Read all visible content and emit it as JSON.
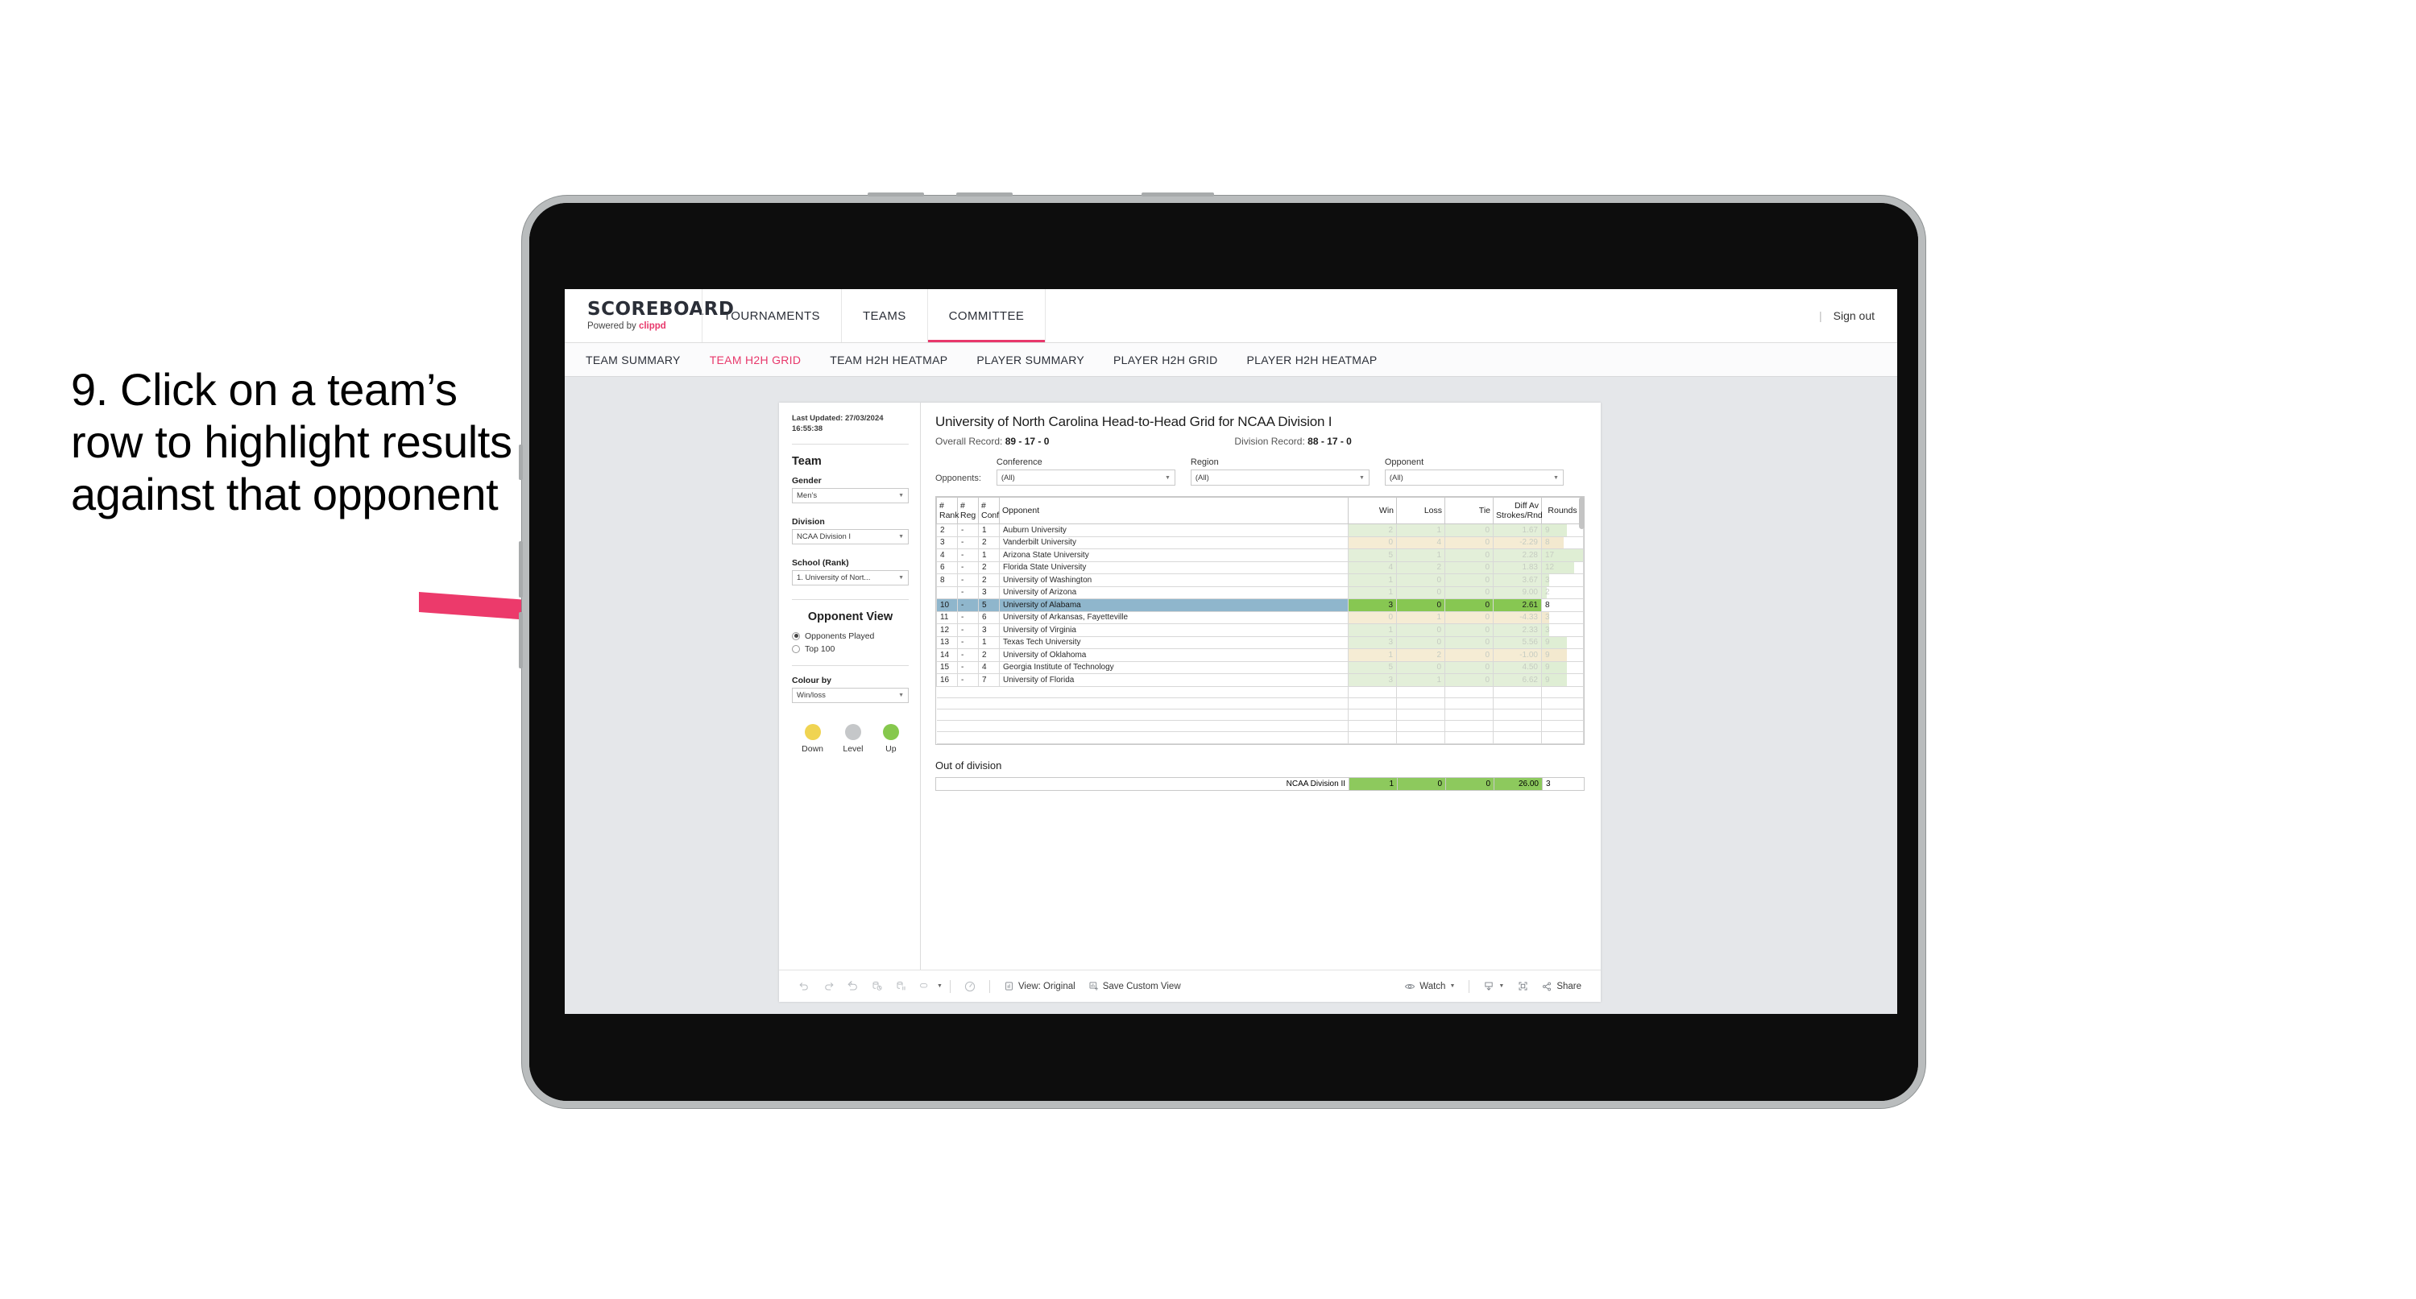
{
  "annotation": {
    "text": "9. Click on a team’s row to highlight results against that opponent",
    "arrow_color": "#EC3A6B"
  },
  "topnav": {
    "brand_name": "SCOREBOARD",
    "brand_sub_prefix": "Powered by ",
    "brand_sub_accent": "clippd",
    "items": [
      {
        "label": "TOURNAMENTS",
        "active": false
      },
      {
        "label": "TEAMS",
        "active": false
      },
      {
        "label": "COMMITTEE",
        "active": true
      }
    ],
    "divider": "|",
    "sign_out": "Sign out",
    "accent_color": "#E8386B"
  },
  "subnav": {
    "items": [
      {
        "label": "TEAM SUMMARY",
        "active": false
      },
      {
        "label": "TEAM H2H GRID",
        "active": true
      },
      {
        "label": "TEAM H2H HEATMAP",
        "active": false
      },
      {
        "label": "PLAYER SUMMARY",
        "active": false
      },
      {
        "label": "PLAYER H2H GRID",
        "active": false
      },
      {
        "label": "PLAYER H2H HEATMAP",
        "active": false
      }
    ]
  },
  "sidebar": {
    "last_updated_line1": "Last Updated: 27/03/2024",
    "last_updated_line2": "16:55:38",
    "team_heading": "Team",
    "gender": {
      "label": "Gender",
      "value": "Men’s"
    },
    "division": {
      "label": "Division",
      "value": "NCAA Division I"
    },
    "school": {
      "label": "School (Rank)",
      "value": "1. University of Nort..."
    },
    "opponent_view": {
      "heading": "Opponent View",
      "options": [
        {
          "label": "Opponents Played",
          "selected": true
        },
        {
          "label": "Top 100",
          "selected": false
        }
      ]
    },
    "colour_by": {
      "label": "Colour by",
      "value": "Win/loss"
    },
    "legend": [
      {
        "label": "Down",
        "color": "#F0D452"
      },
      {
        "label": "Level",
        "color": "#C5C7C9"
      },
      {
        "label": "Up",
        "color": "#86C84D"
      }
    ]
  },
  "main": {
    "title": "University of North Carolina Head-to-Head Grid for NCAA Division I",
    "overall_record_label": "Overall Record:",
    "overall_record_value": "89 - 17 - 0",
    "division_record_label": "Division Record:",
    "division_record_value": "88 - 17 - 0",
    "opponents_label": "Opponents:",
    "filters": [
      {
        "label": "Conference",
        "value": "(All)"
      },
      {
        "label": "Region",
        "value": "(All)"
      },
      {
        "label": "Opponent",
        "value": "(All)"
      }
    ]
  },
  "table": {
    "headers": [
      "#\nRank",
      "#\nReg",
      "#\nConf",
      "Opponent",
      "Win",
      "Loss",
      "Tie",
      "Diff Av\nStrokes/Rnd",
      "Rounds"
    ],
    "header_labels": {
      "rank_l1": "#",
      "rank_l2": "Rank",
      "reg_l1": "#",
      "reg_l2": "Reg",
      "conf_l1": "#",
      "conf_l2": "Conf",
      "opponent": "Opponent",
      "win": "Win",
      "loss": "Loss",
      "tie": "Tie",
      "diff_l1": "Diff Av",
      "diff_l2": "Strokes/Rnd",
      "rounds": "Rounds"
    },
    "rows": [
      {
        "rank": "2",
        "reg": "-",
        "conf": "1",
        "opponent": "Auburn University",
        "win": "2",
        "loss": "1",
        "tie": "0",
        "diff": "1.67",
        "rounds": "9",
        "tone": "up",
        "bar": 60,
        "highlight": false
      },
      {
        "rank": "3",
        "reg": "-",
        "conf": "2",
        "opponent": "Vanderbilt University",
        "win": "0",
        "loss": "4",
        "tie": "0",
        "diff": "-2.29",
        "rounds": "8",
        "tone": "down",
        "bar": 52,
        "highlight": false
      },
      {
        "rank": "4",
        "reg": "-",
        "conf": "1",
        "opponent": "Arizona State University",
        "win": "5",
        "loss": "1",
        "tie": "0",
        "diff": "2.28",
        "rounds": "17",
        "tone": "up",
        "bar": 100,
        "highlight": false
      },
      {
        "rank": "6",
        "reg": "-",
        "conf": "2",
        "opponent": "Florida State University",
        "win": "4",
        "loss": "2",
        "tie": "0",
        "diff": "1.83",
        "rounds": "12",
        "tone": "up",
        "bar": 78,
        "highlight": false
      },
      {
        "rank": "8",
        "reg": "-",
        "conf": "2",
        "opponent": "University of Washington",
        "win": "1",
        "loss": "0",
        "tie": "0",
        "diff": "3.67",
        "rounds": "3",
        "tone": "up",
        "bar": 18,
        "highlight": false
      },
      {
        "rank": "",
        "reg": "-",
        "conf": "3",
        "opponent": "University of Arizona",
        "win": "1",
        "loss": "0",
        "tie": "0",
        "diff": "9.00",
        "rounds": "2",
        "tone": "up",
        "bar": 12,
        "highlight": false
      },
      {
        "rank": "10",
        "reg": "-",
        "conf": "5",
        "opponent": "University of Alabama",
        "win": "3",
        "loss": "0",
        "tie": "0",
        "diff": "2.61",
        "rounds": "8",
        "tone": "up",
        "bar": 52,
        "highlight": true
      },
      {
        "rank": "11",
        "reg": "-",
        "conf": "6",
        "opponent": "University of Arkansas, Fayetteville",
        "win": "0",
        "loss": "1",
        "tie": "0",
        "diff": "-4.33",
        "rounds": "3",
        "tone": "down",
        "bar": 18,
        "highlight": false
      },
      {
        "rank": "12",
        "reg": "-",
        "conf": "3",
        "opponent": "University of Virginia",
        "win": "1",
        "loss": "0",
        "tie": "0",
        "diff": "2.33",
        "rounds": "3",
        "tone": "up",
        "bar": 18,
        "highlight": false
      },
      {
        "rank": "13",
        "reg": "-",
        "conf": "1",
        "opponent": "Texas Tech University",
        "win": "3",
        "loss": "0",
        "tie": "0",
        "diff": "5.56",
        "rounds": "9",
        "tone": "up",
        "bar": 60,
        "highlight": false
      },
      {
        "rank": "14",
        "reg": "-",
        "conf": "2",
        "opponent": "University of Oklahoma",
        "win": "1",
        "loss": "2",
        "tie": "0",
        "diff": "-1.00",
        "rounds": "9",
        "tone": "down",
        "bar": 60,
        "highlight": false
      },
      {
        "rank": "15",
        "reg": "-",
        "conf": "4",
        "opponent": "Georgia Institute of Technology",
        "win": "5",
        "loss": "0",
        "tie": "0",
        "diff": "4.50",
        "rounds": "9",
        "tone": "up",
        "bar": 60,
        "highlight": false
      },
      {
        "rank": "16",
        "reg": "-",
        "conf": "7",
        "opponent": "University of Florida",
        "win": "3",
        "loss": "1",
        "tie": "0",
        "diff": "6.62",
        "rounds": "9",
        "tone": "up",
        "bar": 60,
        "highlight": false
      }
    ],
    "highlight_label_color": "#8FB6CC",
    "highlight_value_color": "#87C752"
  },
  "out_of_division": {
    "title": "Out of division",
    "row": {
      "label": "NCAA Division II",
      "win": "1",
      "loss": "0",
      "tie": "0",
      "diff": "26.00",
      "rounds": "3"
    },
    "color": "#8DC95D"
  },
  "toolbar": {
    "icons": [
      "undo-icon",
      "redo-icon",
      "revert-icon",
      "refresh-data-icon",
      "pause-auto-update-icon",
      "loop-dropdown-icon",
      "dashboard-clock-icon"
    ],
    "view_original": "View: Original",
    "save_custom_view": "Save Custom View",
    "watch": "Watch",
    "share": "Share",
    "download_icon": "download-icon",
    "fullscreen_icon": "fullscreen-icon",
    "share_icon": "share-nodes-icon",
    "eye_icon": "eye-icon"
  }
}
